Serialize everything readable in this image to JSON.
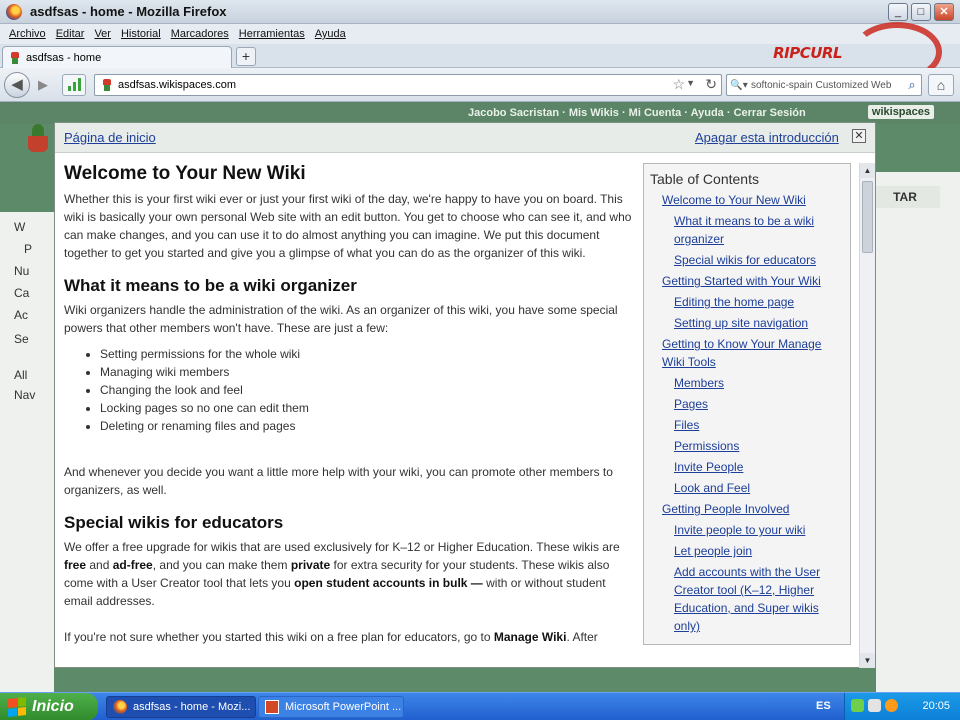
{
  "window": {
    "title": "asdfsas - home - Mozilla Firefox",
    "buttons": {
      "minimize": "_",
      "maximize": "□",
      "close": "✕"
    }
  },
  "menubar": [
    "Archivo",
    "Editar",
    "Ver",
    "Historial",
    "Marcadores",
    "Herramientas",
    "Ayuda"
  ],
  "brand": "RIPCURL",
  "tab": {
    "label": "asdfsas - home",
    "new_tab": "+"
  },
  "nav": {
    "url_domain": "asdfsas.wikispaces.com",
    "search_placeholder": "softonic-spain Customized Web"
  },
  "background_page": {
    "user_bar": "Jacobo Sacristan ·  Mis Wikis  ·  Mi Cuenta  ·  Ayuda  ·  Cerrar Sesión",
    "badge": "wikispaces",
    "tab": "TAR",
    "sidebar": [
      "W",
      "P",
      "Nu",
      "Ca",
      "Ac",
      "Se",
      "All",
      "Nav"
    ]
  },
  "modal": {
    "home_link": "Página de inicio",
    "off_link": "Apagar esta introducción",
    "close": "✕",
    "h1": "Welcome to Your New Wiki",
    "p1": "Whether this is your first wiki ever or just your first wiki of the day, we're happy to have you on board. This wiki is basically your own personal Web site with an edit button. You get to choose who can see it, and who can make changes, and you can use it to do almost anything you can imagine. We put this document together to get you started and give you a glimpse of what you can do as the organizer of this wiki.",
    "h2a": "What it means to be a wiki organizer",
    "p2": "Wiki organizers handle the administration of the wiki. As an organizer of this wiki, you have some special powers that other members won't have. These are just a few:",
    "list": [
      "Setting permissions for the whole wiki",
      "Managing wiki members",
      "Changing the look and feel",
      "Locking pages so no one can edit them",
      "Deleting or renaming files and pages"
    ],
    "p3": "And whenever you decide you want a little more help with your wiki, you can promote other members to organizers, as well.",
    "h2b": "Special wikis for educators",
    "p4": {
      "a": "We offer a free upgrade for wikis that are used exclusively for K–12 or Higher Education. These wikis are ",
      "b1": "free",
      "c": " and ",
      "b2": "ad-free",
      "d": ", and you can make them ",
      "b3": "private",
      "e": " for extra security for your students. These wikis also come with a User Creator tool that lets you ",
      "b4": "open student accounts in bulk —",
      "f": " with or without student email addresses."
    },
    "p5": {
      "a": "If you're not sure whether you started this wiki on a free plan for educators, go to ",
      "b": "Manage Wiki",
      "c": ". After"
    },
    "toc": {
      "title": "Table of Contents",
      "items": [
        {
          "label": "Welcome to Your New Wiki",
          "level": 1
        },
        {
          "label": "What it means to be a wiki organizer",
          "level": 2
        },
        {
          "label": "Special wikis for educators",
          "level": 2
        },
        {
          "label": "Getting Started with Your Wiki",
          "level": 1
        },
        {
          "label": "Editing the home page",
          "level": 2
        },
        {
          "label": "Setting up site navigation",
          "level": 2
        },
        {
          "label": "Getting to Know Your Manage Wiki Tools",
          "level": 1
        },
        {
          "label": "Members",
          "level": 2
        },
        {
          "label": "Pages",
          "level": 2
        },
        {
          "label": "Files",
          "level": 2
        },
        {
          "label": "Permissions",
          "level": 2
        },
        {
          "label": "Invite People",
          "level": 2
        },
        {
          "label": "Look and Feel",
          "level": 2
        },
        {
          "label": "Getting People Involved",
          "level": 1
        },
        {
          "label": "Invite people to your wiki",
          "level": 2
        },
        {
          "label": "Let people join",
          "level": 2
        },
        {
          "label": "Add accounts with the User Creator tool (K–12, Higher Education, and Super wikis only)",
          "level": 2
        }
      ]
    }
  },
  "taskbar": {
    "start": "Inicio",
    "tasks": [
      "asdfsas - home - Mozi...",
      "Microsoft PowerPoint ..."
    ],
    "lang": "ES",
    "clock": "20:05"
  },
  "colors": {
    "link": "#1d3f99",
    "wiki_green": "#5d8a68",
    "taskbar": "#225fd0"
  }
}
